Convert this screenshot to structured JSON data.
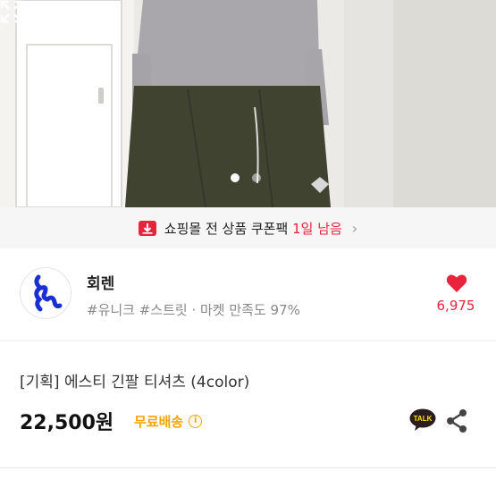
{
  "product_image": {
    "alt": "product photo"
  },
  "carousel": {
    "count": 2,
    "active": 0
  },
  "banner": {
    "text_prefix": "쇼핑몰 전 상품 쿠폰팩",
    "highlight": "1일 남음",
    "chevron": "›",
    "icon": "coupon-icon"
  },
  "shop": {
    "name": "회렌",
    "tags": "#유니크 #스트릿 · 마켓 만족도 97%",
    "likes": "6,975"
  },
  "product": {
    "title": "[기획] 에스티 긴팔 티셔츠 (4color)",
    "price": "22,500원",
    "shipping": "무료배송",
    "shipping_info": "i"
  },
  "colors": {
    "accent_red": "#e8233c",
    "shipping_orange": "#f6a500",
    "kakao_yellow": "#fee500"
  },
  "talk_label": "TALK"
}
